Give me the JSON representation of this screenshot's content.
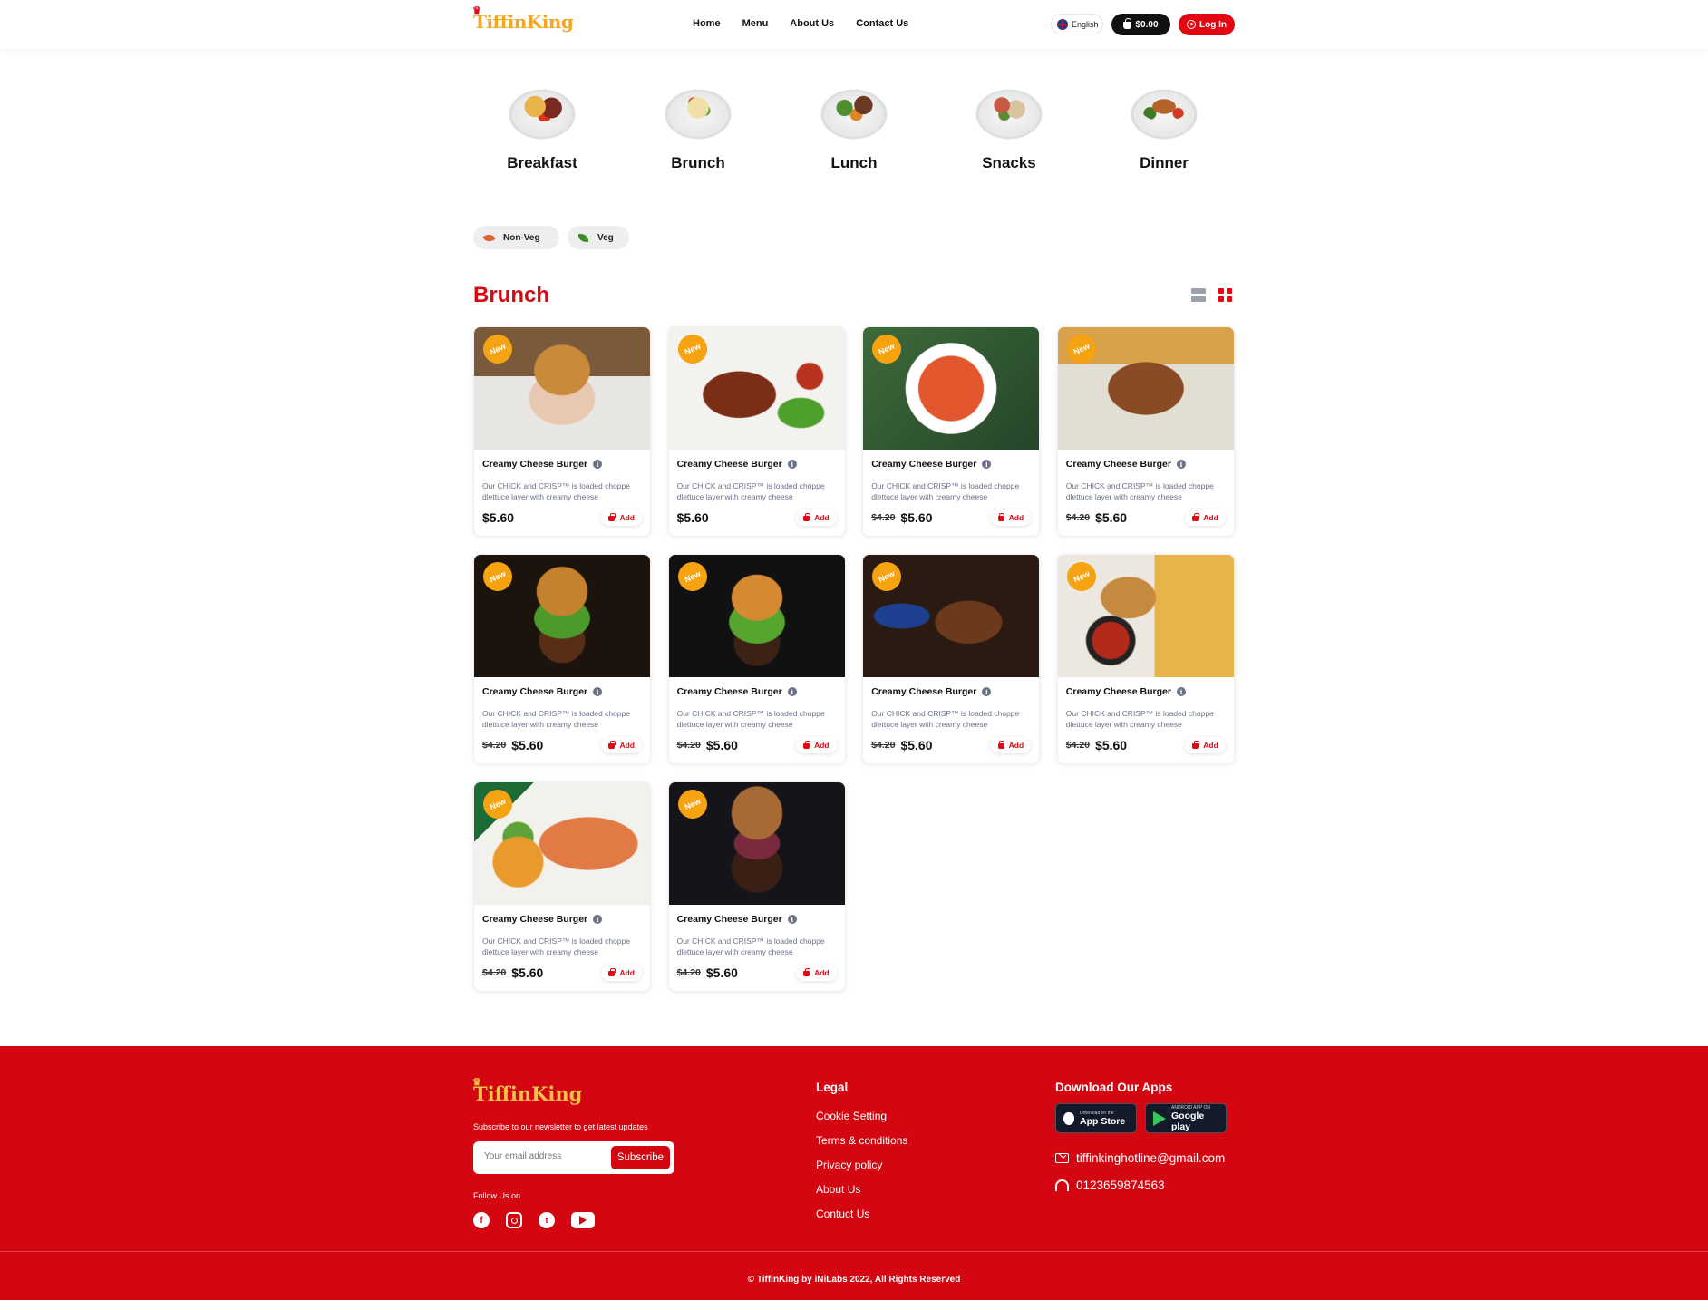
{
  "header": {
    "logo": "TiffinKing",
    "nav": [
      "Home",
      "Menu",
      "About Us",
      "Contact Us"
    ],
    "language": "English",
    "cart_total": "$0.00",
    "login_label": "Log In"
  },
  "categories": [
    {
      "label": "Breakfast",
      "icon": "breakfast-plate"
    },
    {
      "label": "Brunch",
      "icon": "brunch-plate"
    },
    {
      "label": "Lunch",
      "icon": "lunch-plate"
    },
    {
      "label": "Snacks",
      "icon": "snacks-plate"
    },
    {
      "label": "Dinner",
      "icon": "dinner-plate"
    }
  ],
  "filters": [
    {
      "label": "Non-Veg",
      "icon": "drumstick-icon"
    },
    {
      "label": "Veg",
      "icon": "leaf-icon"
    }
  ],
  "section_title": "Brunch",
  "products": [
    {
      "badge": "New",
      "name": "Creamy Cheese Burger",
      "desc": "Our CHICK and CRISP™ is loaded choppe dlettuce layer with creamy cheese",
      "old_price": "",
      "price": "$5.60",
      "add_label": "Add"
    },
    {
      "badge": "New",
      "name": "Creamy Cheese Burger",
      "desc": "Our CHICK and CRISP™ is loaded choppe dlettuce layer with creamy cheese",
      "old_price": "",
      "price": "$5.60",
      "add_label": "Add"
    },
    {
      "badge": "New",
      "name": "Creamy Cheese Burger",
      "desc": "Our CHICK and CRISP™ is loaded choppe dlettuce layer with creamy cheese",
      "old_price": "$4.20",
      "price": "$5.60",
      "add_label": "Add"
    },
    {
      "badge": "New",
      "name": "Creamy Cheese Burger",
      "desc": "Our CHICK and CRISP™ is loaded choppe dlettuce layer with creamy cheese",
      "old_price": "$4.20",
      "price": "$5.60",
      "add_label": "Add"
    },
    {
      "badge": "New",
      "name": "Creamy Cheese Burger",
      "desc": "Our CHICK and CRISP™ is loaded choppe dlettuce layer with creamy cheese",
      "old_price": "$4.20",
      "price": "$5.60",
      "add_label": "Add"
    },
    {
      "badge": "New",
      "name": "Creamy Cheese Burger",
      "desc": "Our CHICK and CRISP™ is loaded choppe dlettuce layer with creamy cheese",
      "old_price": "$4.20",
      "price": "$5.60",
      "add_label": "Add"
    },
    {
      "badge": "New",
      "name": "Creamy Cheese Burger",
      "desc": "Our CHICK and CRISP™ is loaded choppe dlettuce layer with creamy cheese",
      "old_price": "$4.20",
      "price": "$5.60",
      "add_label": "Add"
    },
    {
      "badge": "New",
      "name": "Creamy Cheese Burger",
      "desc": "Our CHICK and CRISP™ is loaded choppe dlettuce layer with creamy cheese",
      "old_price": "$4.20",
      "price": "$5.60",
      "add_label": "Add"
    },
    {
      "badge": "New",
      "name": "Creamy Cheese Burger",
      "desc": "Our CHICK and CRISP™ is loaded choppe dlettuce layer with creamy cheese",
      "old_price": "$4.20",
      "price": "$5.60",
      "add_label": "Add"
    },
    {
      "badge": "New",
      "name": "Creamy Cheese Burger",
      "desc": "Our CHICK and CRISP™ is loaded choppe dlettuce layer with creamy cheese",
      "old_price": "$4.20",
      "price": "$5.60",
      "add_label": "Add"
    }
  ],
  "footer": {
    "logo": "TiffinKing",
    "subscribe_text": "Subscribe to our newsletter to get latest updates",
    "email_placeholder": "Your email address",
    "subscribe_button": "Subscribe",
    "follow_label": "Follow Us on",
    "legal_heading": "Legal",
    "legal_links": [
      "Cookie Setting",
      "Terms & conditions",
      "Privacy policy",
      "About Us",
      "Contuct Us"
    ],
    "apps_heading": "Download Our Apps",
    "app_store": {
      "small": "Download on the",
      "large": "App Store"
    },
    "google_play": {
      "small": "ANDROID APP ON",
      "large": "Google play"
    },
    "email": "tiffinkinghotline@gmail.com",
    "phone": "0123659874563",
    "copyright": "© TiffinKing by iNiLabs 2022, All Rights Reserved"
  },
  "colors": {
    "brand_red": "#d30612",
    "badge_orange": "#f6a312",
    "logo_gold": "#f9c249"
  }
}
